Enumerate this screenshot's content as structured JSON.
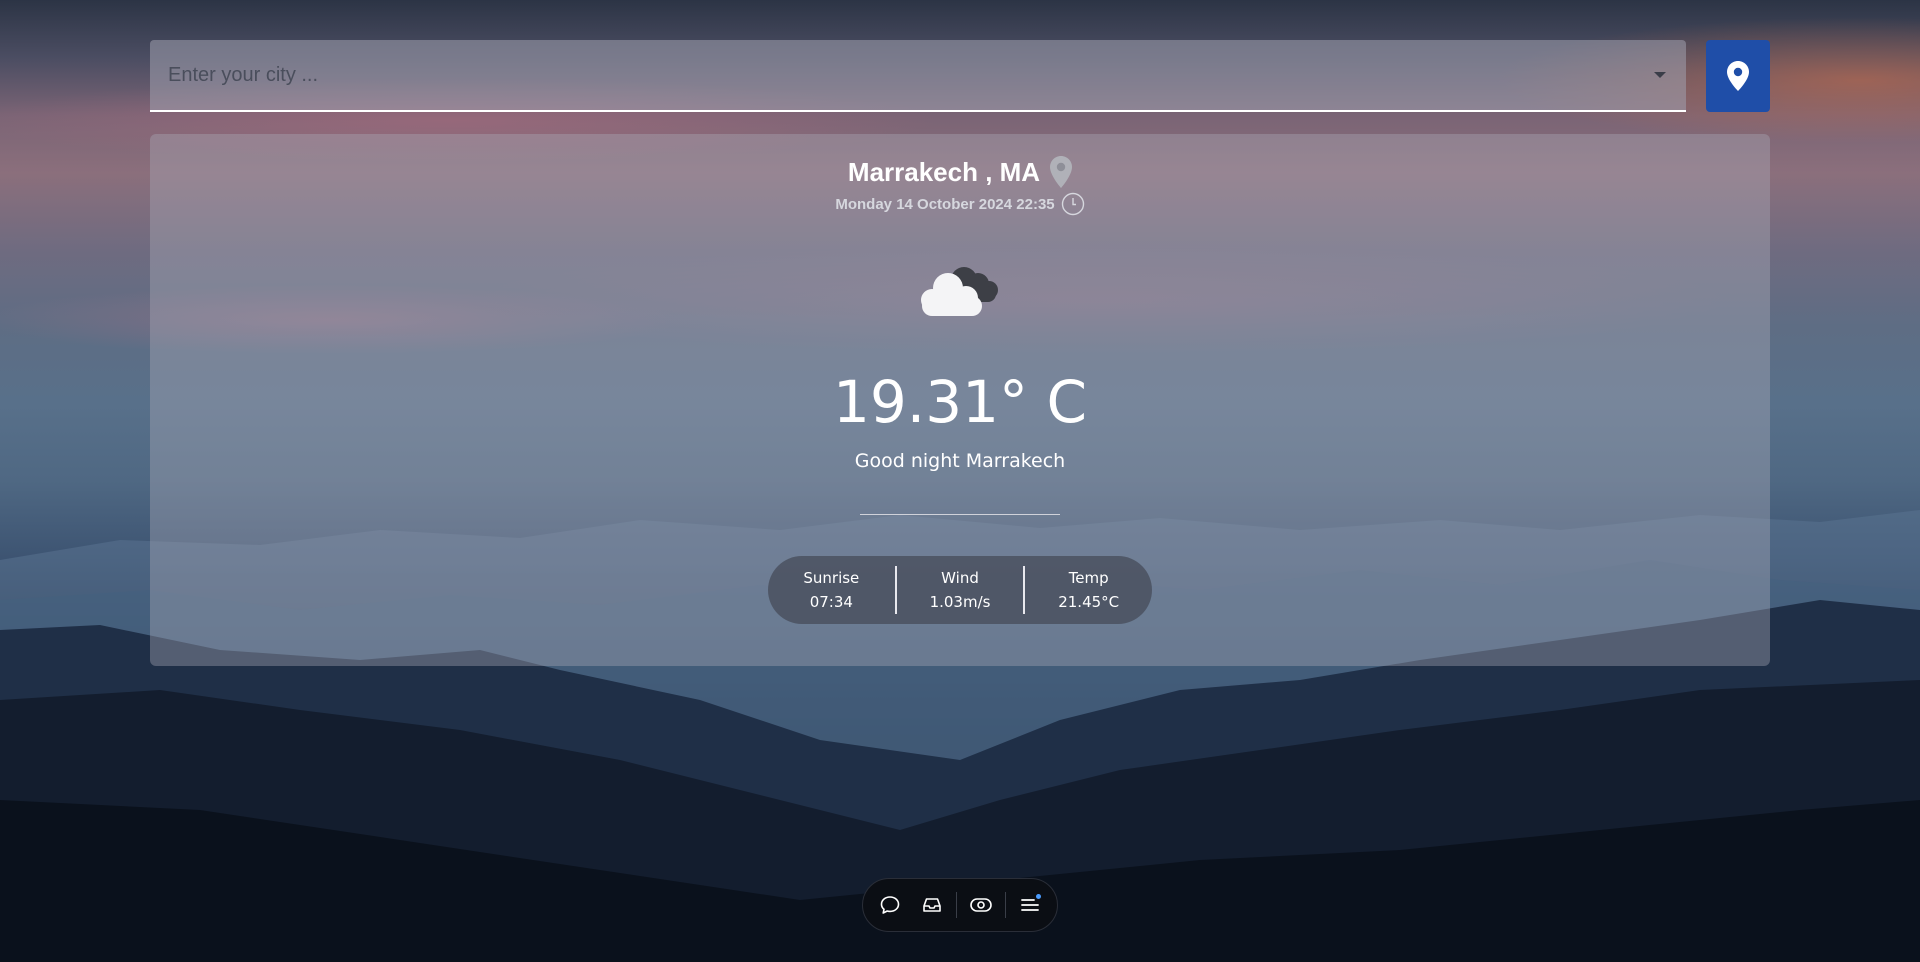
{
  "search": {
    "placeholder": "Enter your city ...",
    "value": ""
  },
  "location": {
    "city": "Marrakech , MA",
    "datetime": "Monday 14 October 2024 22:35"
  },
  "weather": {
    "icon": "cloud-icon",
    "temperature": "19.31° C",
    "greeting": "Good night Marrakech"
  },
  "stats": [
    {
      "label": "Sunrise",
      "value": "07:34"
    },
    {
      "label": "Wind",
      "value": "1.03m/s"
    },
    {
      "label": "Temp",
      "value": "21.45°C"
    }
  ],
  "dock": {
    "items": [
      "chat-bubble-icon",
      "inbox-icon",
      "eye-icon",
      "menu-icon"
    ]
  },
  "colors": {
    "accent": "#1f4ea8",
    "dock_background": "#0b0e14",
    "notification_dot": "#4a9cff"
  }
}
